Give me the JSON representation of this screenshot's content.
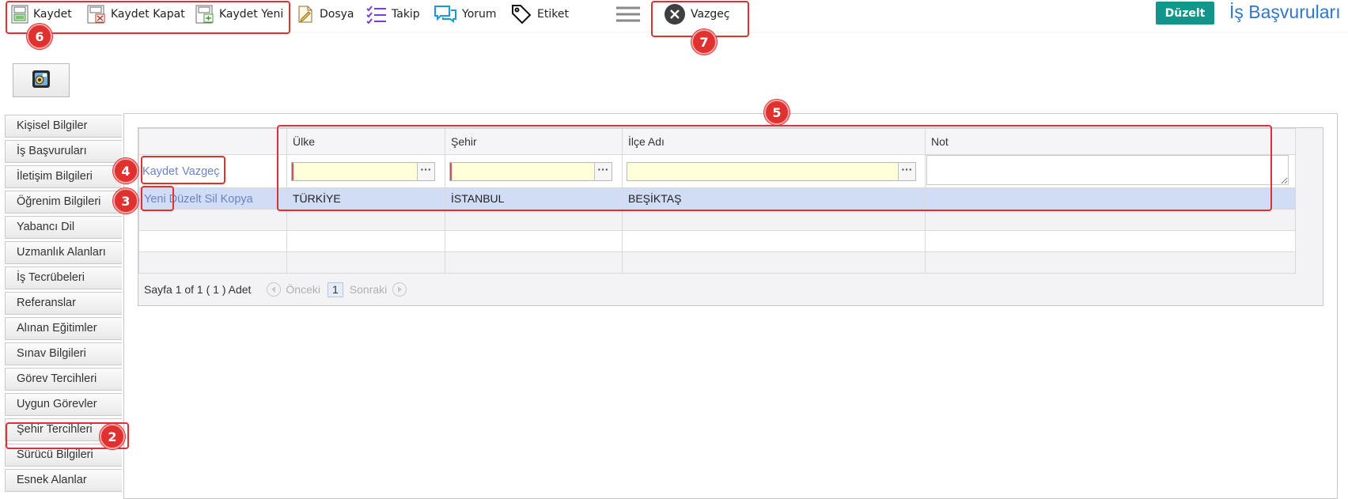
{
  "toolbar": {
    "kaydet": "Kaydet",
    "kaydet_kapat": "Kaydet Kapat",
    "kaydet_yeni": "Kaydet Yeni",
    "dosya": "Dosya",
    "takip": "Takip",
    "yorum": "Yorum",
    "etiket": "Etiket",
    "vazgec": "Vazgeç",
    "duzelt": "Düzelt",
    "page_title": "İş Başvuruları"
  },
  "sidebar": {
    "items": [
      {
        "label": "Kişisel Bilgiler"
      },
      {
        "label": "İş Başvuruları"
      },
      {
        "label": "İletişim Bilgileri"
      },
      {
        "label": "Öğrenim Bilgileri"
      },
      {
        "label": "Yabancı Dil"
      },
      {
        "label": "Uzmanlık Alanları"
      },
      {
        "label": "İş Tecrübeleri"
      },
      {
        "label": "Referanslar"
      },
      {
        "label": "Alınan Eğitimler"
      },
      {
        "label": "Sınav Bilgileri"
      },
      {
        "label": "Görev Tercihleri"
      },
      {
        "label": "Uygun Görevler"
      },
      {
        "label": "Şehir Tercihleri"
      },
      {
        "label": "Sürücü Bilgileri"
      },
      {
        "label": "Esnek Alanlar"
      }
    ]
  },
  "grid": {
    "columns": [
      "Ülke",
      "Şehir",
      "İlçe Adı",
      "Not"
    ],
    "edit_row": {
      "save": "Kaydet",
      "cancel": "Vazgeç",
      "lookup_button": "···"
    },
    "data_row": {
      "commands": {
        "new": "Yeni",
        "edit": "Düzelt",
        "delete": "Sil",
        "copy": "Kopya"
      },
      "ulke": "TÜRKİYE",
      "sehir": "İSTANBUL",
      "ilce": "BEŞİKTAŞ",
      "not": ""
    }
  },
  "pager": {
    "info": "Sayfa 1 of 1 ( 1 ) Adet",
    "prev": "Önceki",
    "page": "1",
    "next": "Sonraki"
  },
  "annotations": {
    "badges": [
      "2",
      "3",
      "4",
      "5",
      "6",
      "7"
    ]
  },
  "colors": {
    "accent_teal": "#10968b",
    "title_blue": "#2f76cc",
    "annotation_red": "#e03131",
    "selected_row": "#d1dcf5",
    "lookup_fill": "#ffffd9"
  }
}
